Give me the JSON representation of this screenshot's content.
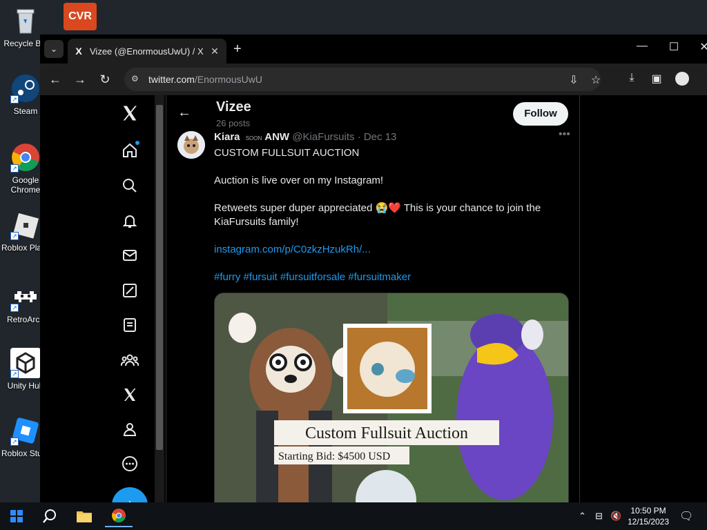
{
  "desktop": {
    "icons": [
      {
        "label": "Recycle Bin"
      },
      {
        "label": "Steam"
      },
      {
        "label": "Google Chrome"
      },
      {
        "label": "Roblox Player"
      },
      {
        "label": "RetroArch"
      },
      {
        "label": "Unity Hub"
      },
      {
        "label": "Roblox Studio"
      }
    ],
    "top_app_label": "CVR"
  },
  "browser": {
    "tab": {
      "title": "Vizee (@EnormousUwU) / X",
      "favicon": "X"
    },
    "url": {
      "host": "twitter.com",
      "path": "/EnormousUwU"
    }
  },
  "profile": {
    "name": "Vizee",
    "posts": "26 posts",
    "follow_label": "Follow"
  },
  "tweet": {
    "display_name": "Kiara",
    "badge": "SOON",
    "badge_suffix": "ANW",
    "handle": "@KiaFursuits",
    "date": "· Dec 13",
    "lines": [
      "CUSTOM FULLSUIT AUCTION",
      "Auction is live over on my Instagram!",
      "Retweets super duper appreciated 😭❤️ This is your chance to join the KiaFursuits family!"
    ],
    "link": "instagram.com/p/C0zkzHzukRh/...",
    "hashtags": "#furry #fursuit #fursuitforsale #fursuitmaker",
    "media": {
      "title": "Custom Fullsuit Auction",
      "subtitle": "Starting Bid: $4500 USD"
    }
  },
  "taskbar": {
    "time": "10:50 PM",
    "date": "12/15/2023"
  },
  "colors": {
    "accent": "#1d9bf0",
    "bg": "#000000",
    "text": "#e7e9ea",
    "muted": "#71767b"
  }
}
